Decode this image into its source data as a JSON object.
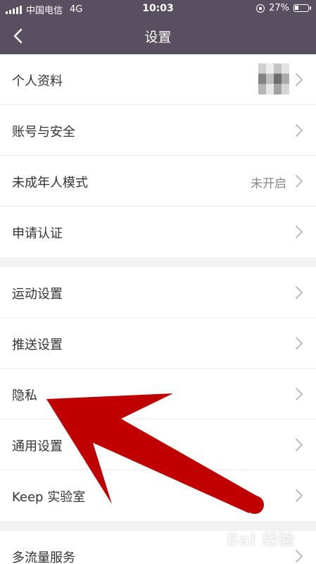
{
  "status_bar": {
    "carrier": "中国电信",
    "network": "4G",
    "time": "10:03",
    "battery_percent": "27%",
    "battery_level": 0.27
  },
  "nav": {
    "title": "设置",
    "back_icon": "chevron-left-icon"
  },
  "groups": [
    {
      "rows": [
        {
          "label": "个人资料",
          "value": "",
          "has_avatar": true
        },
        {
          "label": "账号与安全",
          "value": ""
        },
        {
          "label": "未成年人模式",
          "value": "未开启"
        },
        {
          "label": "申请认证",
          "value": ""
        }
      ]
    },
    {
      "rows": [
        {
          "label": "运动设置",
          "value": ""
        },
        {
          "label": "推送设置",
          "value": ""
        },
        {
          "label": "隐私",
          "value": ""
        },
        {
          "label": "通用设置",
          "value": ""
        },
        {
          "label": "Keep 实验室",
          "value": ""
        }
      ]
    },
    {
      "rows": [
        {
          "label": "多流量服务",
          "value": ""
        }
      ]
    }
  ],
  "colors": {
    "header_bg": "#584f60",
    "annotation_arrow": "#c00000"
  },
  "watermark": "Bai 经验"
}
